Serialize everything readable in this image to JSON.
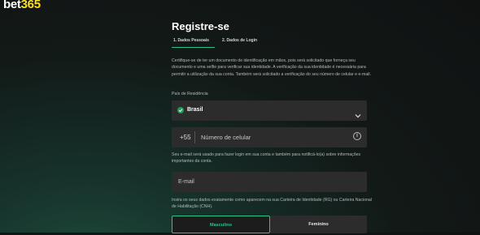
{
  "brand": {
    "logo_main": "bet",
    "logo_accent": "365"
  },
  "form": {
    "title": "Registre-se",
    "steps": [
      {
        "label": "1. Dados Pessoais",
        "active": true
      },
      {
        "label": "2. Dados de Login",
        "active": false
      }
    ],
    "intro": "Certifique-se de ter um documento de identificação em mãos, pois será solicitado que forneça seu documento e uma selfie para verificar sua identidade. A verificação da sua identidade é necessária para permitir a utilização da sua conta. Também será solicitado a verificação do seu número de celular e e-mail.",
    "country": {
      "label": "País de Residência",
      "value": "Brasil"
    },
    "phone": {
      "prefix": "+55",
      "placeholder": "Número de celular"
    },
    "email_note": "Seu e-mail será usado para fazer login em sua conta e também para notificá-lo(a) sobre informações importantes da conta.",
    "email": {
      "placeholder": "E-mail"
    },
    "id_note": "Insira os seus dados exatamente como aparecem na sua Carteira de Identidade (RG) ou Carteira Nacional de Habilitação (CNH).",
    "gender": {
      "male": "Masculino",
      "female": "Feminino",
      "selected": "male"
    }
  },
  "colors": {
    "accent": "#2bc48a",
    "brand_yellow": "#ffdf1b",
    "field_bg": "#2c2c2c"
  }
}
